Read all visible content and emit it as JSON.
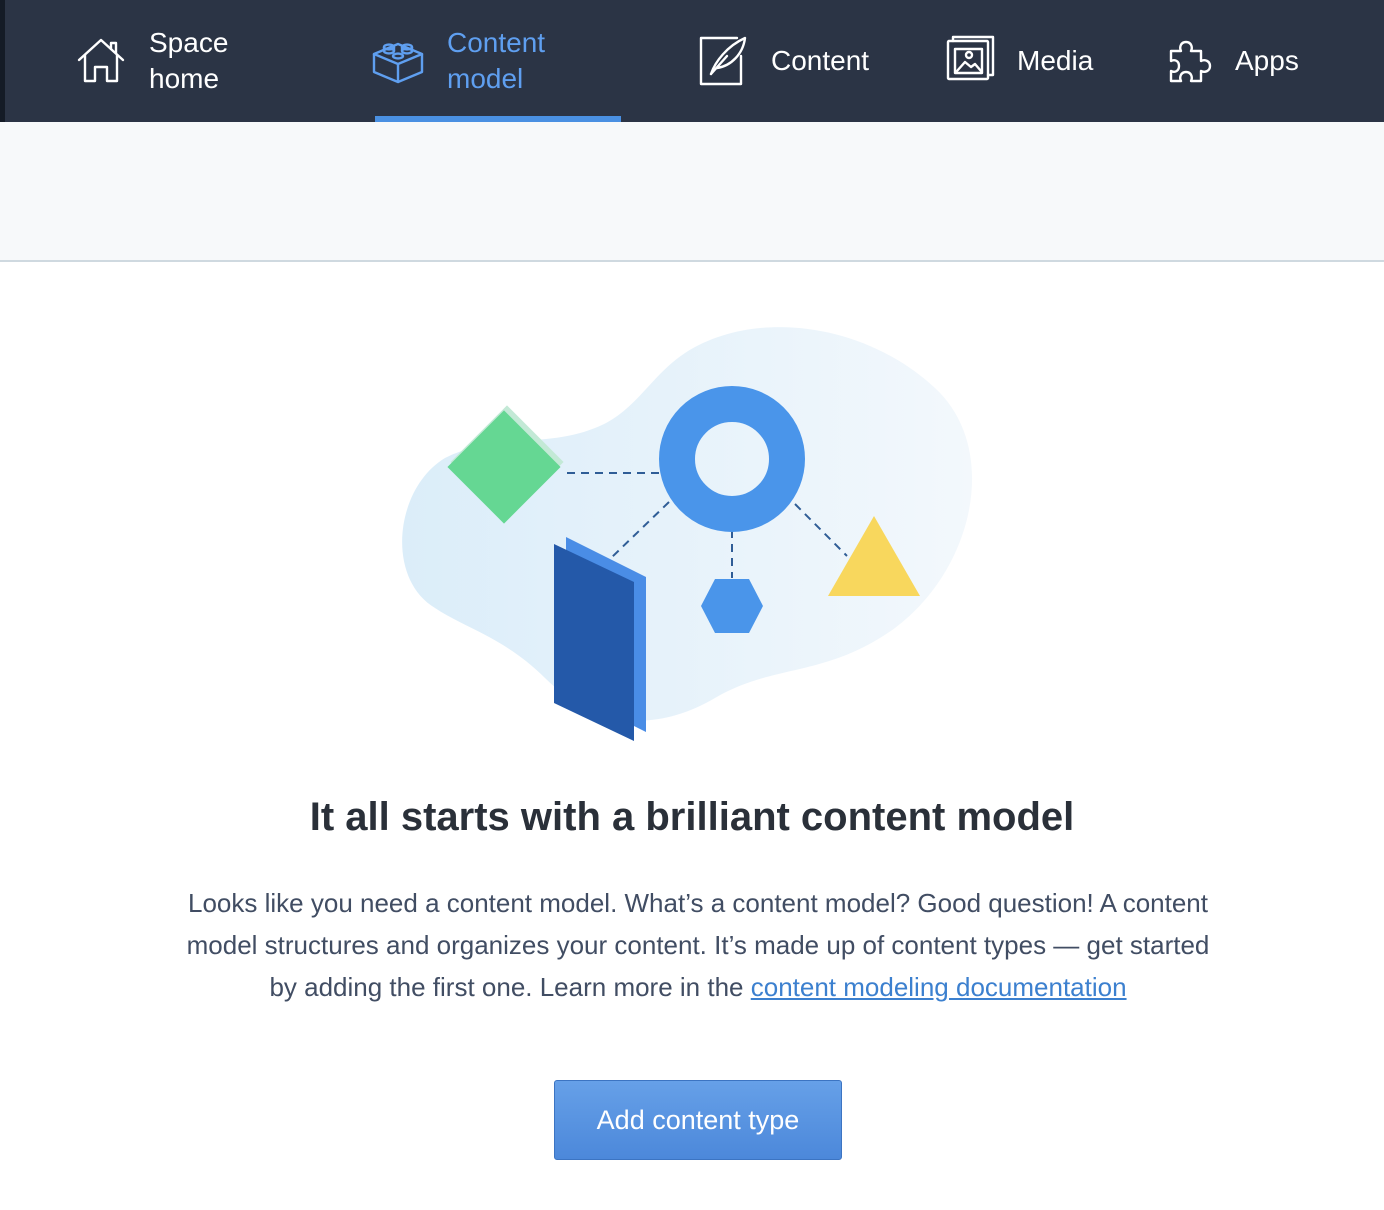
{
  "nav": {
    "items": [
      {
        "label_line1": "Space",
        "label_line2": "home",
        "icon": "home-icon",
        "active": false
      },
      {
        "label_line1": "Content",
        "label_line2": "model",
        "icon": "content-model-icon",
        "active": true
      },
      {
        "label": "Content",
        "icon": "content-icon",
        "active": false
      },
      {
        "label": "Media",
        "icon": "media-icon",
        "active": false
      },
      {
        "label": "Apps",
        "icon": "apps-icon",
        "active": false
      }
    ],
    "colors": {
      "background": "#2b3445",
      "active": "#5f9ff0",
      "active_bar": "#4a90e2"
    }
  },
  "empty_state": {
    "title": "It all starts with a brilliant content model",
    "body": "Looks like you need a content model. What’s a content model? Good question! A content model structures and organizes your content. It’s made up of content types — get started by adding the first one. Learn more in the ",
    "link_text": "content modeling documentation",
    "button_label": "Add content type",
    "illustration": {
      "shapes": [
        "green-diamond",
        "blue-ring",
        "yellow-triangle",
        "blue-hexagon",
        "dark-blue-panel"
      ],
      "colors": {
        "blob": "#e3f1fb",
        "green": "#65d793",
        "blue": "#4a95ea",
        "yellow": "#f8d75d",
        "dark_blue": "#2459a9"
      }
    }
  }
}
